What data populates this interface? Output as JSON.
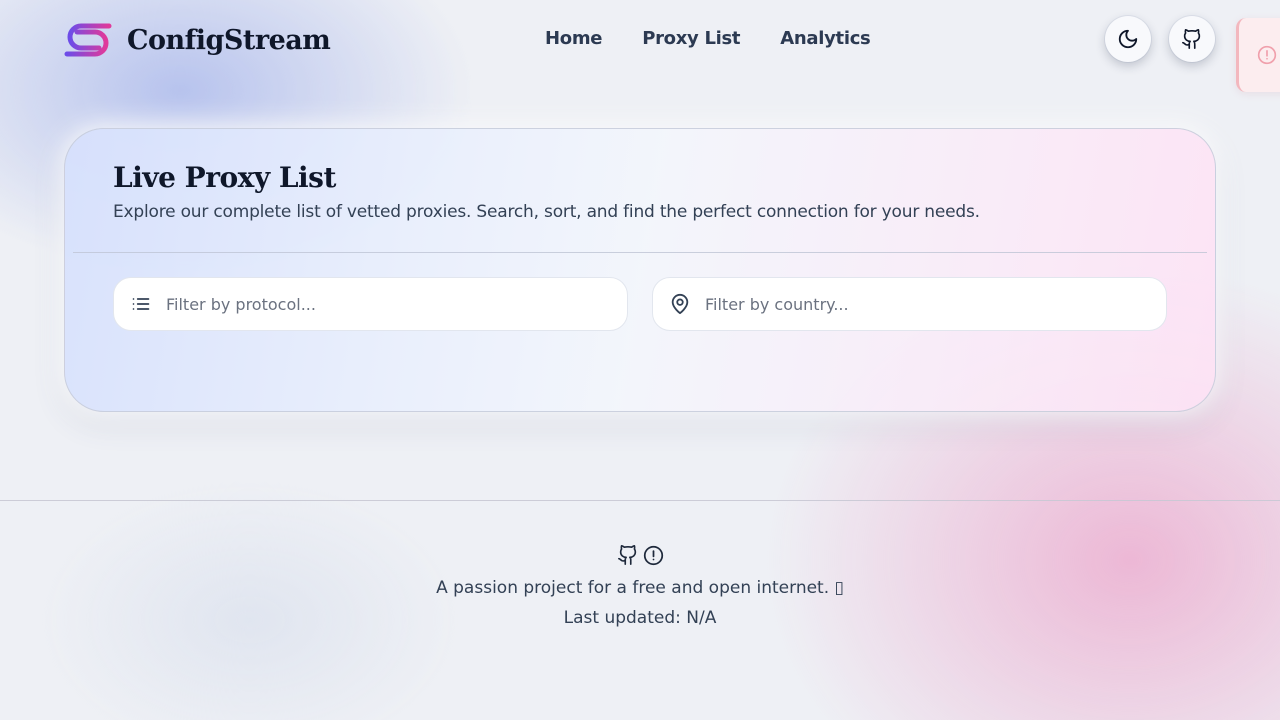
{
  "brand": {
    "name": "ConfigStream",
    "logo_colors": [
      "#6d4ce8",
      "#e03a9a"
    ]
  },
  "nav": {
    "items": [
      {
        "label": "Home"
      },
      {
        "label": "Proxy List"
      },
      {
        "label": "Analytics"
      }
    ]
  },
  "header_actions": {
    "theme_icon": "moon-icon",
    "github_icon": "github-icon",
    "alert_icon": "alert-circle-icon"
  },
  "card": {
    "title": "Live Proxy List",
    "subtitle": "Explore our complete list of vetted proxies. Search, sort, and find the perfect connection for your needs.",
    "filters": {
      "protocol": {
        "icon": "list-icon",
        "placeholder": "Filter by protocol...",
        "value": ""
      },
      "country": {
        "icon": "map-pin-icon",
        "placeholder": "Filter by country...",
        "value": ""
      }
    }
  },
  "footer": {
    "icons": [
      "github-icon",
      "alert-circle-icon"
    ],
    "tagline": "A passion project for a free and open internet. ",
    "missing_glyph": "▯",
    "last_updated_label": "Last updated: ",
    "last_updated_value": "N/A"
  },
  "colors": {
    "text_primary": "#0f172a",
    "text_secondary": "#334155",
    "accent_purple": "#6d4ce8",
    "accent_pink": "#e03a9a"
  }
}
